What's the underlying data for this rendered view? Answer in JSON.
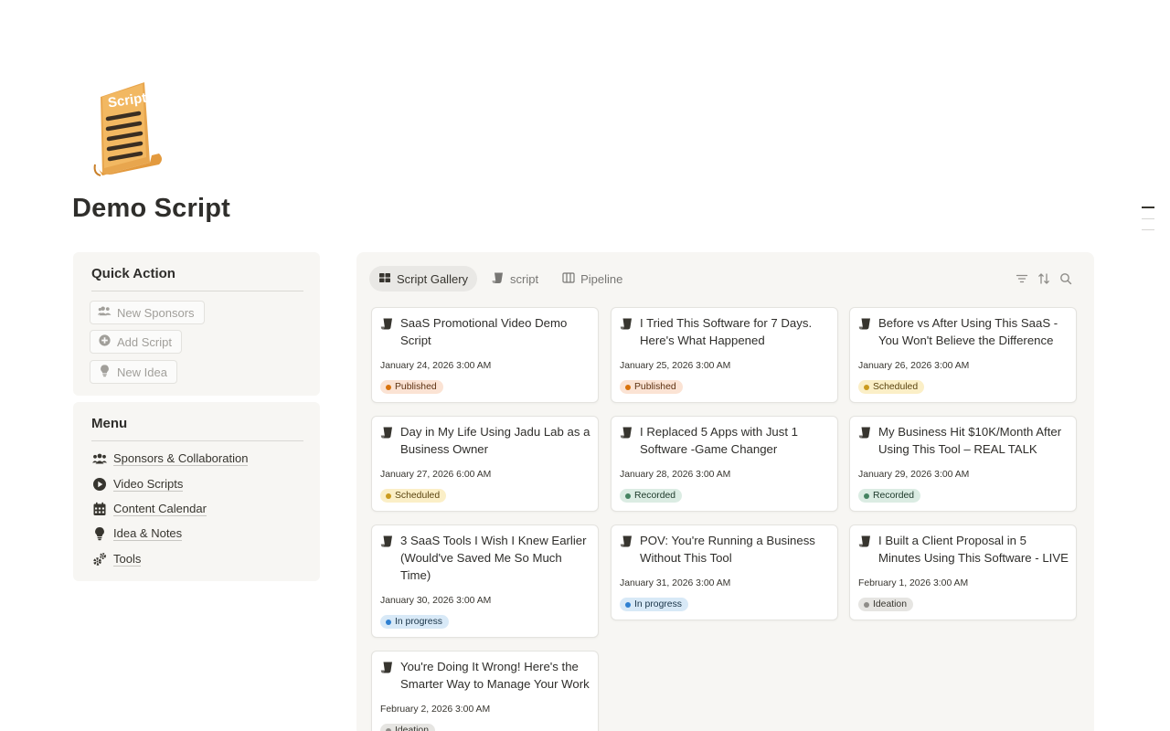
{
  "page": {
    "title": "Demo Script",
    "icon": "script-scroll-icon",
    "icon_text": "Script"
  },
  "quick_action": {
    "title": "Quick Action",
    "buttons": [
      {
        "label": "New Sponsors",
        "icon": "people-icon"
      },
      {
        "label": "Add Script",
        "icon": "plus-circle-icon"
      },
      {
        "label": "New Idea",
        "icon": "lightbulb-icon"
      }
    ]
  },
  "menu": {
    "title": "Menu",
    "items": [
      {
        "label": "Sponsors & Collaboration",
        "icon": "people-icon"
      },
      {
        "label": "Video Scripts",
        "icon": "play-circle-icon"
      },
      {
        "label": "Content Calendar",
        "icon": "calendar-icon"
      },
      {
        "label": "Idea & Notes",
        "icon": "lightbulb-icon"
      },
      {
        "label": "Tools",
        "icon": "gears-icon"
      }
    ]
  },
  "gallery": {
    "tabs": [
      {
        "label": "Script Gallery",
        "icon": "gallery-grid-icon",
        "active": true
      },
      {
        "label": "script",
        "icon": "scroll-icon",
        "active": false
      },
      {
        "label": "Pipeline",
        "icon": "board-columns-icon",
        "active": false
      }
    ],
    "tools": [
      "filter-icon",
      "sort-icon",
      "search-icon"
    ],
    "status_colors": {
      "Published": {
        "bg": "#fbe3d4",
        "dot": "#d9730d",
        "text": "#5e3313"
      },
      "Scheduled": {
        "bg": "#fbefc7",
        "dot": "#cb9b1e",
        "text": "#5b4510"
      },
      "Recorded": {
        "bg": "#dbece3",
        "dot": "#448361",
        "text": "#1c3829"
      },
      "In progress": {
        "bg": "#d8e9f7",
        "dot": "#2f80d1",
        "text": "#183347"
      },
      "Ideation": {
        "bg": "#e6e5e2",
        "dot": "#8e8c88",
        "text": "#37352f"
      }
    },
    "cards": [
      {
        "title": "SaaS Promotional Video Demo Script",
        "date": "January 24, 2026 3:00 AM",
        "status": "Published"
      },
      {
        "title": "I Tried This Software for 7 Days. Here's What Happened",
        "date": "January 25, 2026 3:00 AM",
        "status": "Published"
      },
      {
        "title": "Before vs After Using This SaaS - You Won't Believe the Difference",
        "date": "January 26, 2026 3:00 AM",
        "status": "Scheduled"
      },
      {
        "title": "Day in My Life Using Jadu Lab as a Business Owner",
        "date": "January 27, 2026 6:00 AM",
        "status": "Scheduled"
      },
      {
        "title": "I Replaced 5 Apps with Just 1 Software -Game Changer",
        "date": "January 28, 2026 3:00 AM",
        "status": "Recorded"
      },
      {
        "title": "My Business Hit $10K/Month After Using This Tool – REAL TALK",
        "date": "January 29, 2026 3:00 AM",
        "status": "Recorded"
      },
      {
        "title": "3 SaaS Tools I Wish I Knew Earlier (Would've Saved Me So Much Time)",
        "date": "January 30, 2026 3:00 AM",
        "status": "In progress"
      },
      {
        "title": "POV: You're Running a Business Without This Tool",
        "date": "January 31, 2026 3:00 AM",
        "status": "In progress"
      },
      {
        "title": "I Built a Client Proposal in 5 Minutes Using This Software - LIVE",
        "date": "February 1, 2026 3:00 AM",
        "status": "Ideation"
      },
      {
        "title": "You're Doing It Wrong! Here's the Smarter Way to Manage Your Work",
        "date": "February 2, 2026 3:00 AM",
        "status": "Ideation"
      }
    ]
  }
}
